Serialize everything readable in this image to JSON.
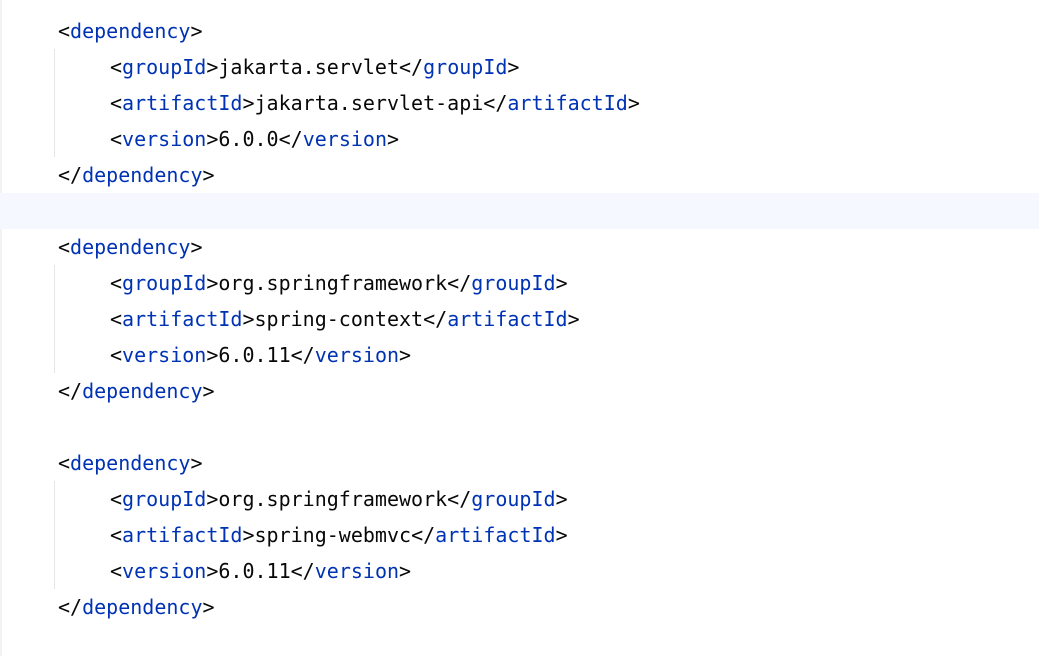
{
  "editor": {
    "colors": {
      "tag": "#0033b3",
      "text": "#080808",
      "current_line": "#f5f8fe"
    },
    "blocks": [
      {
        "open_tag": "dependency",
        "close_tag": "dependency",
        "children": [
          {
            "tag": "groupId",
            "value": "jakarta.servlet"
          },
          {
            "tag": "artifactId",
            "value": "jakarta.servlet-api"
          },
          {
            "tag": "version",
            "value": "6.0.0"
          }
        ]
      },
      {
        "open_tag": "dependency",
        "close_tag": "dependency",
        "children": [
          {
            "tag": "groupId",
            "value": "org.springframework"
          },
          {
            "tag": "artifactId",
            "value": "spring-context"
          },
          {
            "tag": "version",
            "value": "6.0.11"
          }
        ]
      },
      {
        "open_tag": "dependency",
        "close_tag": "dependency",
        "children": [
          {
            "tag": "groupId",
            "value": "org.springframework"
          },
          {
            "tag": "artifactId",
            "value": "spring-webmvc"
          },
          {
            "tag": "version",
            "value": "6.0.11"
          }
        ]
      }
    ]
  }
}
